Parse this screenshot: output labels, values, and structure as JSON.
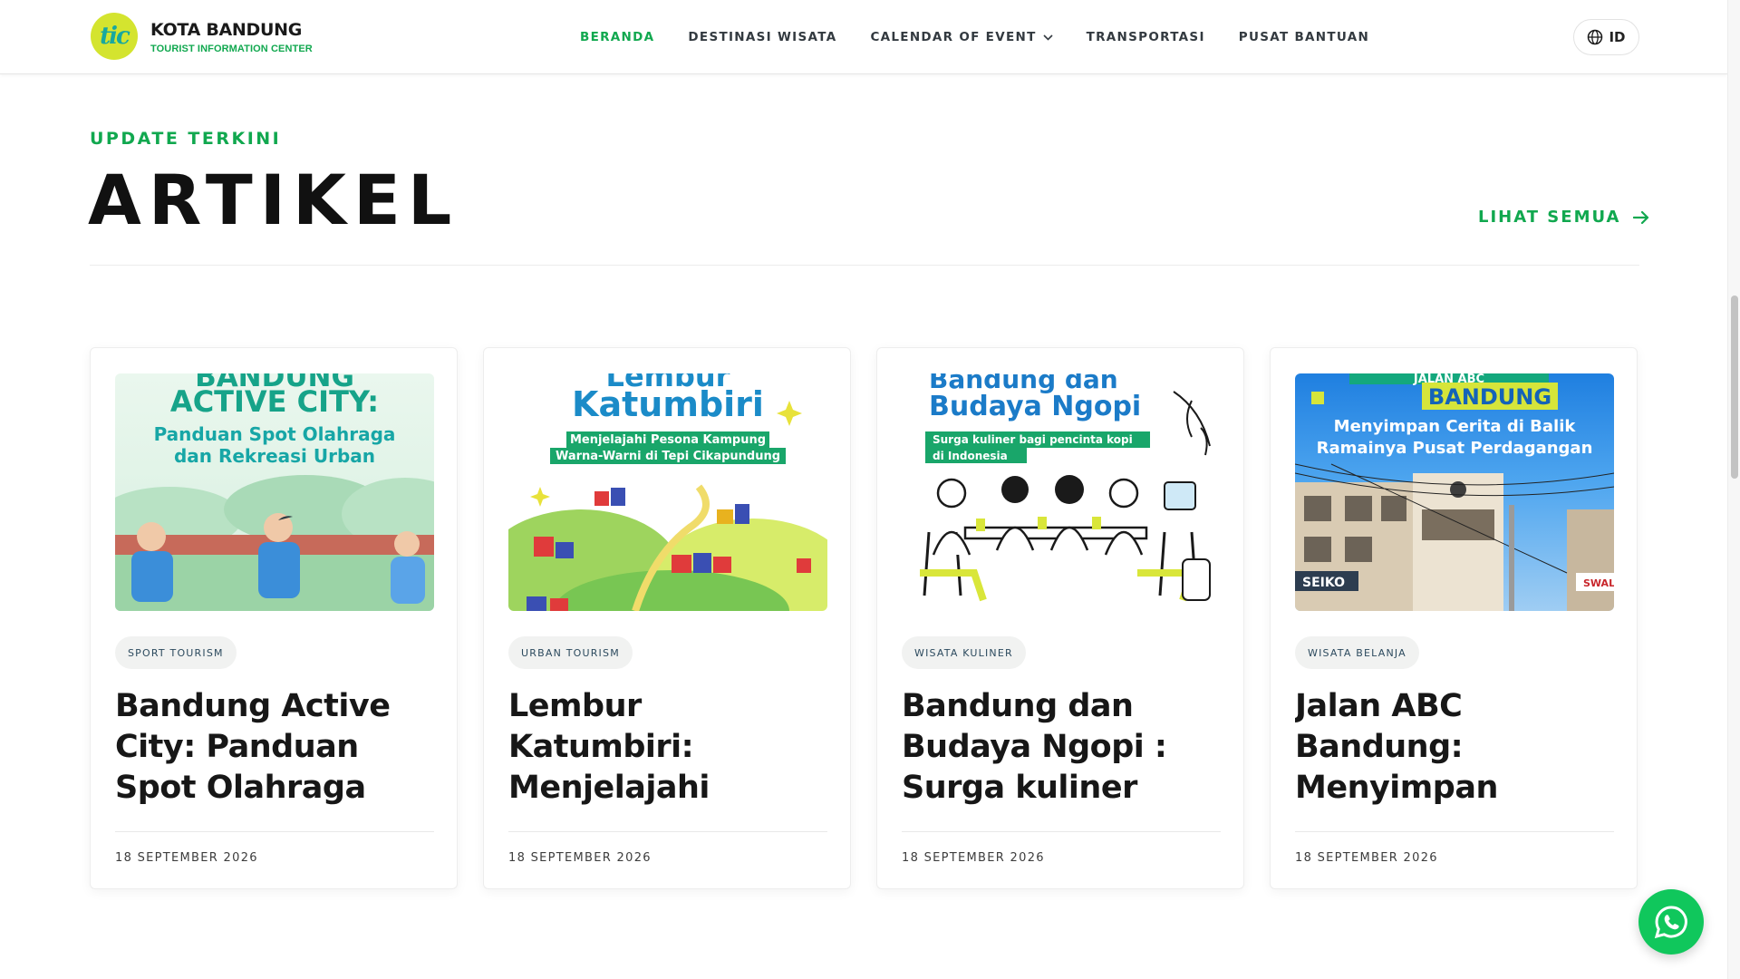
{
  "header": {
    "brand_mark": "tic",
    "brand_title": "KOTA BANDUNG",
    "brand_sub": "TOURIST INFORMATION CENTER",
    "nav": [
      {
        "label": "BERANDA",
        "active": true
      },
      {
        "label": "DESTINASI WISATA",
        "active": false
      },
      {
        "label": "CALENDAR OF EVENT",
        "active": false,
        "has_dropdown": true
      },
      {
        "label": "TRANSPORTASI",
        "active": false
      },
      {
        "label": "PUSAT BANTUAN",
        "active": false
      }
    ],
    "language": "ID"
  },
  "section": {
    "eyebrow": "UPDATE TERKINI",
    "title": "ARTIKEL",
    "see_all": "LIHAT SEMUA"
  },
  "cards": [
    {
      "tag": "SPORT TOURISM",
      "title": "Bandung Active City: Panduan Spot Olahraga dan...",
      "date": "18 SEPTEMBER 2026",
      "image": {
        "line0": "BANDUNG",
        "line1": "ACTIVE CITY:",
        "line2": "Panduan Spot Olahraga",
        "line3": "dan Rekreasi Urban"
      }
    },
    {
      "tag": "URBAN TOURISM",
      "title": "Lembur Katumbiri: Menjelajahi Pesona Kampung Warna-...",
      "date": "18 SEPTEMBER 2026",
      "image": {
        "line0": "Lembur",
        "line1": "Katumbiri",
        "line2": "Menjelajahi Pesona Kampung",
        "line3": "Warna-Warni di Tepi Cikapundung"
      }
    },
    {
      "tag": "WISATA KULINER",
      "title": "Bandung dan Budaya Ngopi : Surga kuliner bagi...",
      "date": "18 SEPTEMBER 2026",
      "image": {
        "line0": "Bandung dan",
        "line1": "Budaya Ngopi",
        "line2": "Surga kuliner bagi pencinta kopi",
        "line3": "di Indonesia"
      }
    },
    {
      "tag": "WISATA BELANJA",
      "title": "Jalan ABC Bandung: Menyimpan Cerita...",
      "date": "18 SEPTEMBER 2026",
      "image": {
        "line0": "JALAN ABC",
        "line1": "BANDUNG",
        "line2": "Menyimpan Cerita di Balik",
        "line3": "Ramainya Pusat Perdagangan",
        "sign": "SEIKO",
        "sign2": "SWAL"
      }
    }
  ],
  "colors": {
    "accent": "#11a84f",
    "whatsapp": "#10c75c"
  },
  "icons": {
    "language": "globe-icon",
    "see_all": "arrow-right-icon",
    "chat": "whatsapp-icon"
  }
}
